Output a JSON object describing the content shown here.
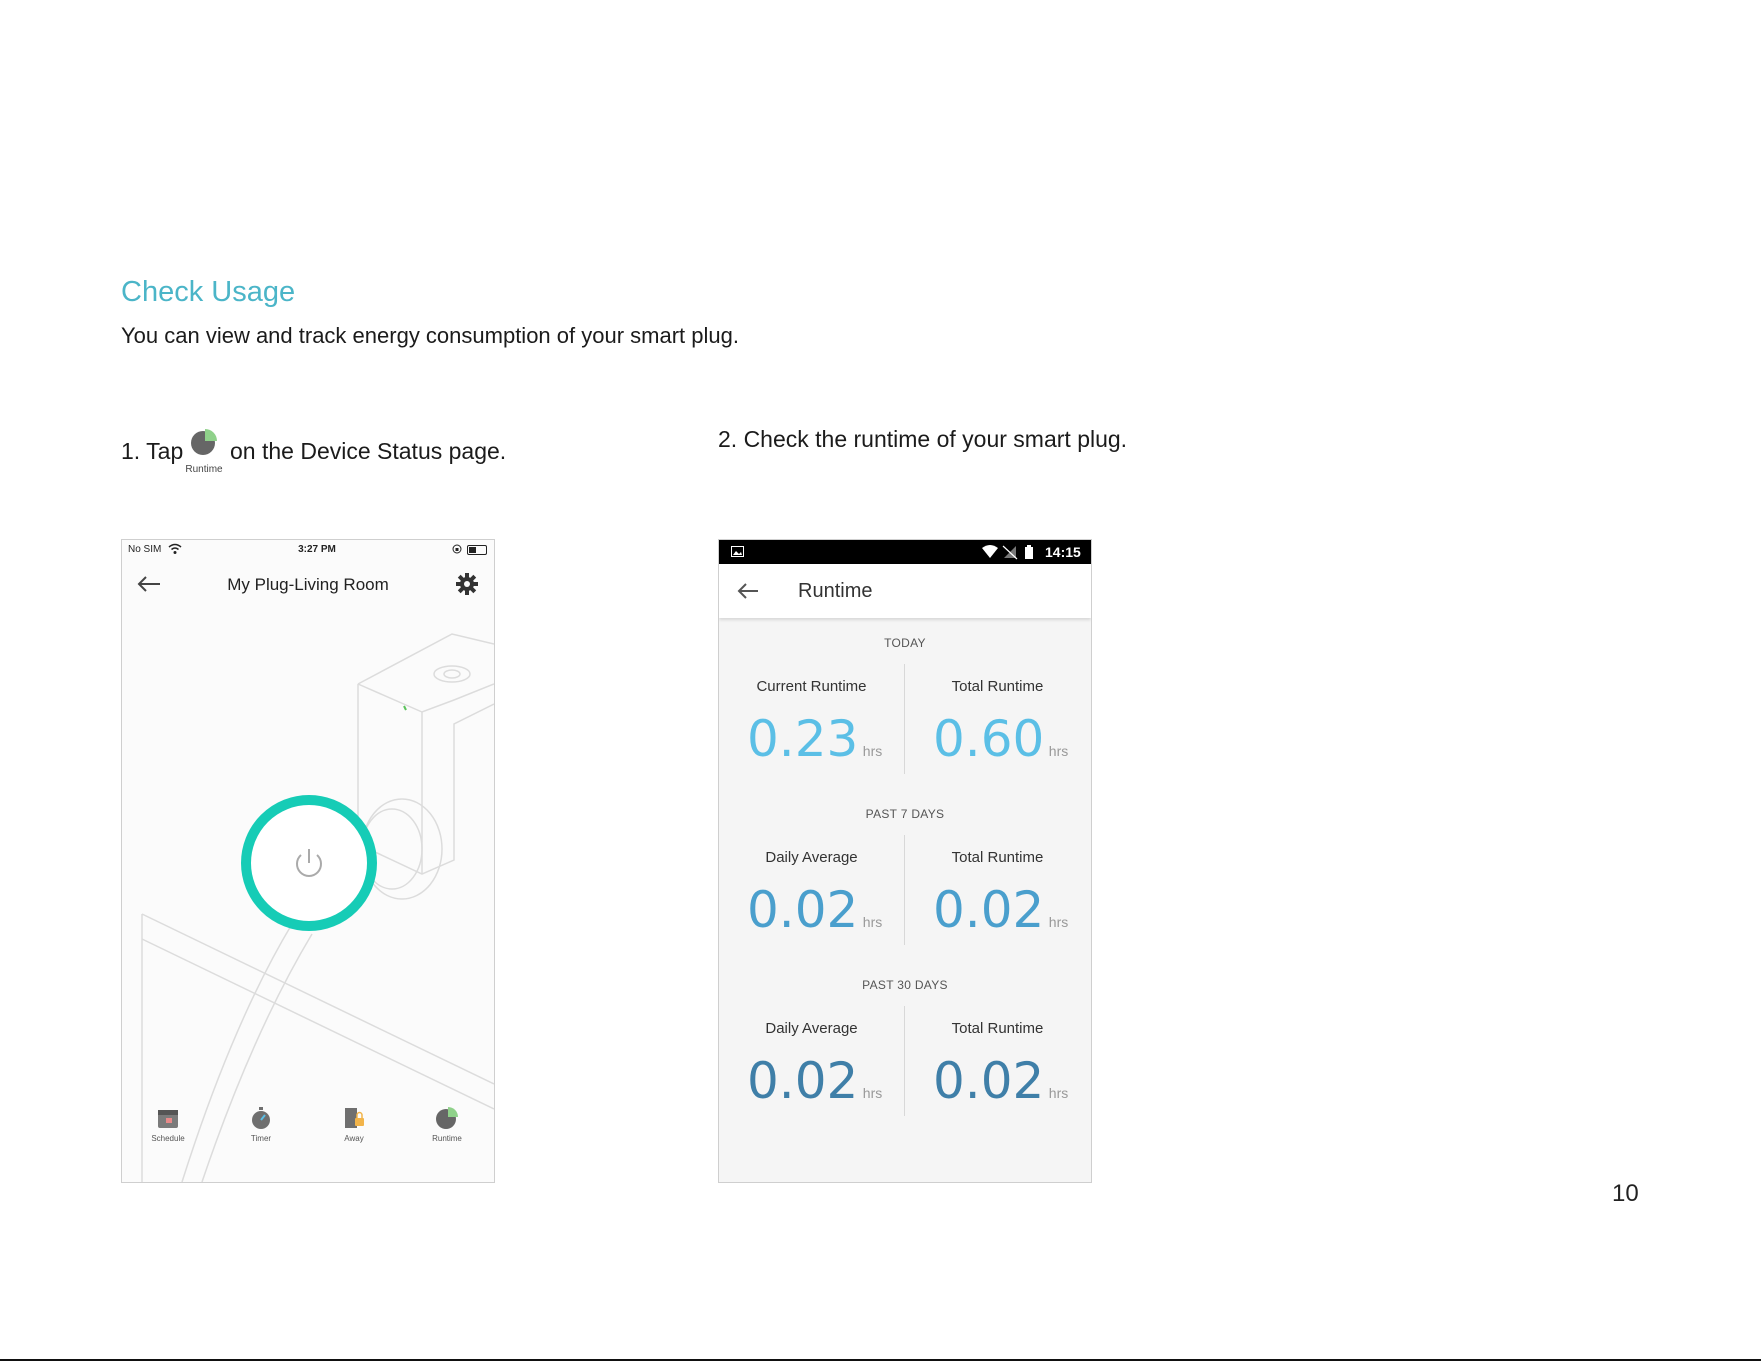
{
  "doc": {
    "title": "Check Usage",
    "description": "You can view and track energy consumption of your smart plug.",
    "step1_prefix": "1. Tap",
    "step1_icon_label": "Runtime",
    "step1_suffix": "on the Device Status page.",
    "step2": "2. Check the runtime of your smart plug.",
    "page_number": "10"
  },
  "phone1": {
    "status": {
      "carrier": "No SIM",
      "time": "3:27 PM",
      "battery_level": 0.45
    },
    "title": "My Plug-Living Room",
    "tabs": [
      {
        "label": "Schedule",
        "icon": "calendar-icon"
      },
      {
        "label": "Timer",
        "icon": "stopwatch-icon"
      },
      {
        "label": "Away",
        "icon": "away-lock-icon"
      },
      {
        "label": "Runtime",
        "icon": "pie-chart-icon"
      }
    ],
    "colors": {
      "power_ring": "#16ccb6",
      "runtime_accent": "#8fd18a"
    }
  },
  "phone2": {
    "status": {
      "time": "14:15"
    },
    "title": "Runtime",
    "sections": [
      {
        "heading": "TODAY",
        "left": {
          "label": "Current Runtime",
          "value": "0.23",
          "unit": "hrs"
        },
        "right": {
          "label": "Total Runtime",
          "value": "0.60",
          "unit": "hrs"
        }
      },
      {
        "heading": "PAST 7 DAYS",
        "left": {
          "label": "Daily Average",
          "value": "0.02",
          "unit": "hrs"
        },
        "right": {
          "label": "Total Runtime",
          "value": "0.02",
          "unit": "hrs"
        }
      },
      {
        "heading": "PAST 30 DAYS",
        "left": {
          "label": "Daily Average",
          "value": "0.02",
          "unit": "hrs"
        },
        "right": {
          "label": "Total Runtime",
          "value": "0.02",
          "unit": "hrs"
        }
      }
    ],
    "colors": {
      "today": "#5bbfe6",
      "past_7": "#4a9fcd",
      "past_30": "#3f7fa8"
    }
  }
}
